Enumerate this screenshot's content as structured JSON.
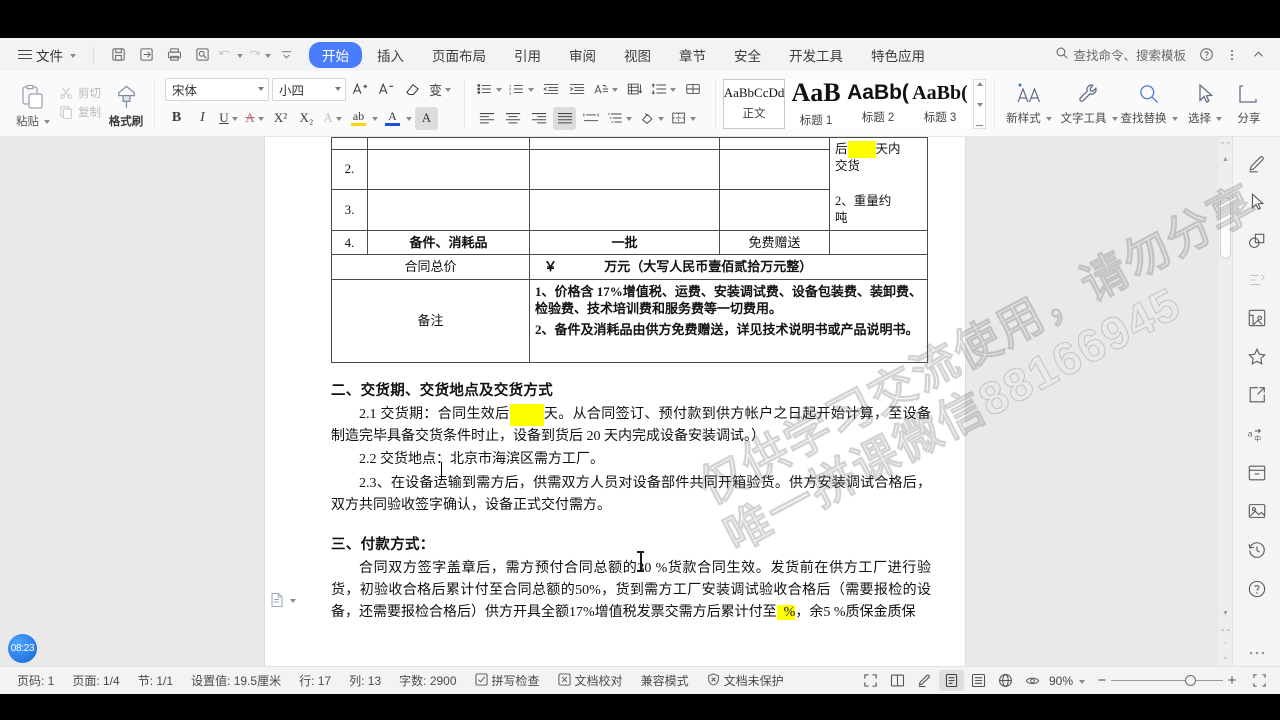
{
  "menubar": {
    "file_label": "文件",
    "quick_icons": [
      "save-icon",
      "save-as-icon",
      "print-icon",
      "print-preview-icon",
      "undo-icon",
      "redo-icon",
      "customize-quick-access-icon"
    ],
    "tabs": [
      {
        "label": "开始",
        "active": true
      },
      {
        "label": "插入",
        "active": false
      },
      {
        "label": "页面布局",
        "active": false
      },
      {
        "label": "引用",
        "active": false
      },
      {
        "label": "审阅",
        "active": false
      },
      {
        "label": "视图",
        "active": false
      },
      {
        "label": "章节",
        "active": false
      },
      {
        "label": "安全",
        "active": false
      },
      {
        "label": "开发工具",
        "active": false
      },
      {
        "label": "特色应用",
        "active": false
      }
    ],
    "search_placeholder": "查找命令、搜索模板",
    "help_icon": "help-icon",
    "more_icon": "more-vertical-icon",
    "collapse_icon": "chevron-up-icon"
  },
  "ribbon": {
    "clipboard": {
      "paste": "粘贴",
      "cut": "剪切",
      "copy": "复制",
      "format_painter": "格式刷"
    },
    "font": {
      "family_value": "宋体",
      "size_value": "小四",
      "grow_font": "A",
      "shrink_font": "A",
      "clear_format": "clear-formatting-icon",
      "pinyin_guide": "变",
      "bold": "B",
      "italic": "I",
      "underline": "U",
      "strikethrough": "A",
      "superscript": "X²",
      "subscript": "X₂",
      "char_border": "A",
      "highlight": "ab",
      "font_color": "A",
      "char_shading": "A"
    },
    "paragraph": {
      "bullets": "bullet-list-icon",
      "numbering": "numbered-list-icon",
      "decrease_indent": "decrease-indent-icon",
      "increase_indent": "increase-indent-icon",
      "asian_layout": "asian-layout-icon",
      "sort": "sort-icon",
      "line_spacing": "line-spacing-icon",
      "show_marks": "show-paragraph-marks-icon",
      "align_left": "align-left-icon",
      "align_center": "align-center-icon",
      "align_right": "align-right-icon",
      "align_justify": "align-justify-icon",
      "distribute": "distribute-icon",
      "list_level": "multilevel-list-icon",
      "shading": "shading-icon",
      "borders": "borders-icon"
    },
    "styles": [
      {
        "preview": "AaBbCcDd",
        "name": "正文",
        "selected": true
      },
      {
        "preview": "AaB",
        "name": "标题 1",
        "selected": false
      },
      {
        "preview": "AaBb(",
        "name": "标题 2",
        "selected": false
      },
      {
        "preview": "AaBb(",
        "name": "标题 3",
        "selected": false
      }
    ],
    "tools": [
      {
        "label": "新样式",
        "icon": "new-style-icon",
        "dropdown": true
      },
      {
        "label": "文字工具",
        "icon": "wrench-icon",
        "dropdown": true
      },
      {
        "label": "查找替换",
        "icon": "search-icon",
        "dropdown": true
      },
      {
        "label": "选择",
        "icon": "cursor-select-icon",
        "dropdown": true
      },
      {
        "label": "分享",
        "icon": "share-icon",
        "dropdown": true
      }
    ]
  },
  "document": {
    "table": {
      "rows": [
        {
          "num": "2.",
          "name": "",
          "qty": "",
          "price": ""
        },
        {
          "num": "3.",
          "name": "",
          "qty": "",
          "price": ""
        },
        {
          "num": "4.",
          "name": "备件、消耗品",
          "qty": "一批",
          "price": "免费赠送"
        }
      ],
      "note_cell_lines": [
        "后",
        "天内",
        "交货",
        "2、重量约",
        "吨"
      ],
      "total_label": "合同总价",
      "total_value_prefix": "￥",
      "total_value_text": "万元（大写人民币壹佰贰拾万元整）",
      "remark_label": "备注",
      "remark_items": [
        "1、价格含 17%增值税、运费、安装调试费、设备包装费、装卸费、检验费、技术培训费和服务费等一切费用。",
        "2、备件及消耗品由供方免费赠送，详见技术说明书或产品说明书。"
      ]
    },
    "section2_heading": "二、交货期、交货地点及交货方式",
    "p21_before": "2.1 交货期：合同生效后",
    "p21_after": "天。从合同签订、预付款到供方帐户之日起开始计算，至设备制造完毕具备交货条件时止，设备到货后 20 天内完成设备安装调试。）",
    "p22": "2.2 交货地点：北京市海滨区需方工厂。",
    "p23": "2.3、在设备运输到需方后，供需双方人员对设备部件共同开箱验货。供方安装调试合格后，双方共同验收签字确认，设备正式交付需方。",
    "section3_heading": "三、付款方式：",
    "p31_a": "合同双方签字盖章后，需方预付合同总额的30 %货款合同生效。发货前在供方工厂进行验货，初验收合格后累计付至合同总额的50%，货到需方工厂安装调试验收合格后（需要报检的设备，还需要报检合格后）供方开具全额17%增值税发票交需方后累计付至",
    "p31_pct": "%",
    "p31_b": "，余5 %质保金质保"
  },
  "watermark": {
    "line1": "仅供学习交流使用，请勿分享",
    "line2": "唯一拼课微信88166945"
  },
  "right_dock": [
    {
      "icon": "pen-comment-icon"
    },
    {
      "icon": "cursor-arrow-icon"
    },
    {
      "icon": "shapes-icon"
    },
    {
      "icon": "translate-faint-icon"
    },
    {
      "icon": "photo-gallery-icon"
    },
    {
      "icon": "star-favorite-icon"
    },
    {
      "icon": "share-export-icon"
    },
    {
      "icon": "text-convert-icon"
    },
    {
      "icon": "archive-box-icon"
    },
    {
      "icon": "image-insert-icon"
    },
    {
      "icon": "history-icon"
    },
    {
      "icon": "help-circle-icon"
    },
    {
      "icon": "more-dots-icon"
    }
  ],
  "statusbar": {
    "items": [
      "页码: 1",
      "页面: 1/4",
      "节: 1/1",
      "设置值: 19.5厘米",
      "行: 17",
      "列: 13",
      "字数: 2900"
    ],
    "spell_check": "拼写检查",
    "proofread": "文档校对",
    "compat_mode": "兼容模式",
    "protection": "文档未保护",
    "view_buttons": [
      "fullscreen-icon",
      "two-page-icon",
      "edit-pen-icon",
      "print-layout-icon",
      "web-layout-icon",
      "web-view-icon",
      "eye-view-icon"
    ],
    "zoom_label": "90%",
    "zoom_minus": "−",
    "zoom_plus": "+",
    "fit_icon": "fit-page-icon"
  },
  "time_badge": "08:23",
  "colors": {
    "accent": "#4a7dfd",
    "highlight": "#ffff00",
    "ribbon_bg": "#fafafa",
    "workspace_bg": "#e9e9e9"
  }
}
